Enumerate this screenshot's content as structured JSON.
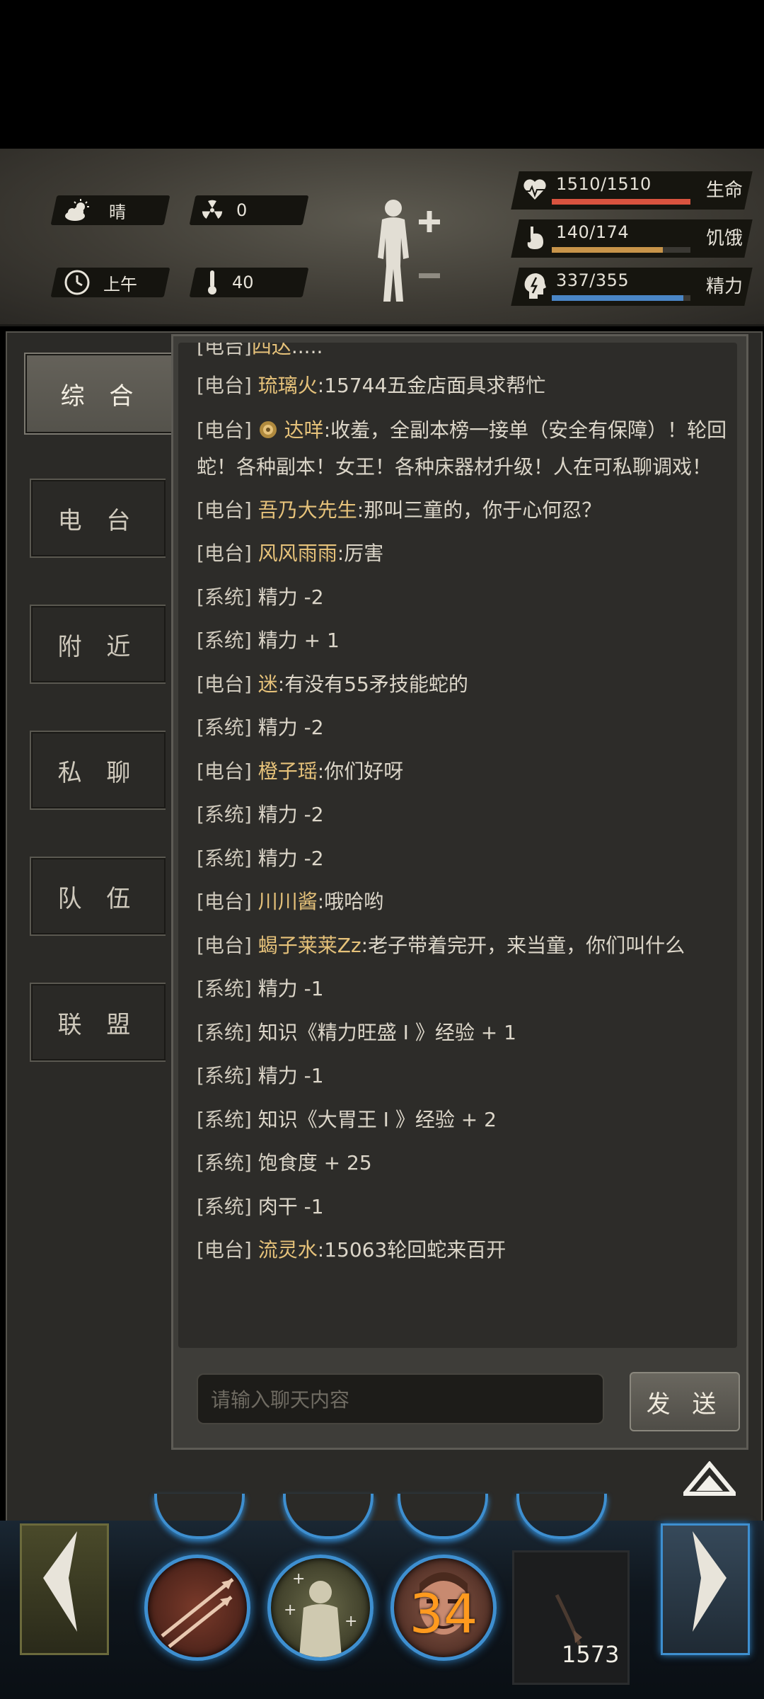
{
  "status": {
    "weather": "晴",
    "radiation": "0",
    "time_of_day": "上午",
    "temperature": "40",
    "hp": {
      "text": "1510/1510",
      "label": "生命",
      "fraction": 1.0,
      "color": "#d9533f"
    },
    "hunger": {
      "text": "140/174",
      "label": "饥饿",
      "fraction": 0.8,
      "color": "#c8944a"
    },
    "energy": {
      "text": "337/355",
      "label": "精力",
      "fraction": 0.95,
      "color": "#4a86c6"
    }
  },
  "tabs": [
    "综 合",
    "电 台",
    "附 近",
    "私 聊",
    "队 伍",
    "联 盟"
  ],
  "active_tab_index": 0,
  "chat": {
    "messages": [
      {
        "channel": "[电台]",
        "name": "四达",
        "text": ".....",
        "partial": true
      },
      {
        "channel": "[电台]",
        "name": "琉璃火",
        "text": ":15744五金店面具求帮忙"
      },
      {
        "channel": "[电台]",
        "name": "达咩",
        "text": ":收羞，全副本榜一接单（安全有保障）！轮回蛇！各种副本！女王！各种床器材升级！人在可私聊调戏！",
        "badge": true,
        "wrap": true
      },
      {
        "channel": "[电台]",
        "name": "吾乃大先生",
        "text": ":那叫三童的，你于心何忍？"
      },
      {
        "channel": "[电台]",
        "name": "风风雨雨",
        "text": ":厉害"
      },
      {
        "channel": "[系统]",
        "name": "",
        "text": "精力 -2"
      },
      {
        "channel": "[系统]",
        "name": "",
        "text": "精力 + 1"
      },
      {
        "channel": "[电台]",
        "name": "迷",
        "text": ":有没有55矛技能蛇的"
      },
      {
        "channel": "[系统]",
        "name": "",
        "text": "精力 -2"
      },
      {
        "channel": "[电台]",
        "name": "橙子瑶",
        "text": ":你们好呀"
      },
      {
        "channel": "[系统]",
        "name": "",
        "text": "精力 -2"
      },
      {
        "channel": "[系统]",
        "name": "",
        "text": "精力 -2"
      },
      {
        "channel": "[电台]",
        "name": "川川酱",
        "text": ":哦哈哟"
      },
      {
        "channel": "[电台]",
        "name": "蝎子莱莱Zz",
        "text": ":老子带着完开，来当童，你们叫什么"
      },
      {
        "channel": "[系统]",
        "name": "",
        "text": "精力 -1"
      },
      {
        "channel": "[系统]",
        "name": "",
        "text": "知识《精力旺盛 I 》经验 + 1"
      },
      {
        "channel": "[系统]",
        "name": "",
        "text": "精力 -1"
      },
      {
        "channel": "[系统]",
        "name": "",
        "text": "知识《大胃王 I 》经验 + 2"
      },
      {
        "channel": "[系统]",
        "name": "",
        "text": "饱食度 + 25"
      },
      {
        "channel": "[系统]",
        "name": "",
        "text": "肉干 -1"
      },
      {
        "channel": "[电台]",
        "name": "流灵水",
        "text": ":15063轮回蛇来百开"
      }
    ],
    "input_placeholder": "请输入聊天内容",
    "send_label": "发 送"
  },
  "bottom": {
    "skill_counter": "34",
    "item_count": "1573"
  },
  "icons": [
    "sun-cloud-icon",
    "radiation-icon",
    "clock-icon",
    "thermometer-icon",
    "body-status-icon",
    "heart-icon",
    "stomach-icon",
    "energy-head-icon",
    "collapse-chevron-icon",
    "arrows-skill-icon",
    "heal-skill-icon",
    "face-skill-icon",
    "item-slot-icon"
  ]
}
